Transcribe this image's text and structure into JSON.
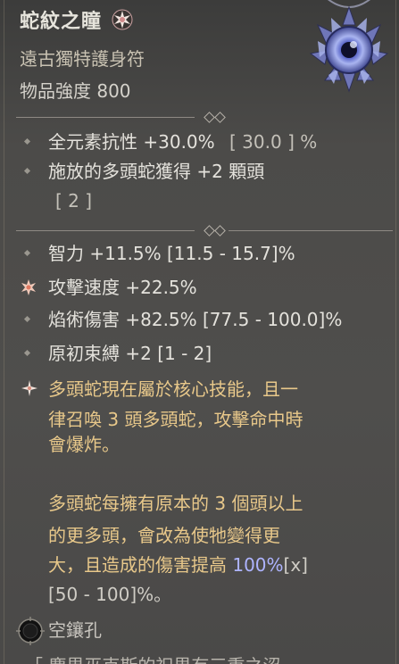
{
  "item": {
    "name": "蛇紋之瞳",
    "type": "遠古獨特護身符",
    "power": "物品強度 800"
  },
  "implicit": [
    {
      "text": "全元素抗性 +30.0%",
      "range": "[ 30.0 ] %"
    },
    {
      "text": "施放的多頭蛇獲得 +2 顆頭",
      "range": "[ 2 ]"
    }
  ],
  "affixes": [
    {
      "text": "智力 +11.5% [11.5 - 15.7]%",
      "bullet": "diamond"
    },
    {
      "text": "攻擊速度 +22.5%",
      "bullet": "star"
    },
    {
      "text": "焰術傷害 +82.5% [77.5 - 100.0]%",
      "bullet": "diamond"
    },
    {
      "text": "原初束縛 +2 [1 - 2]",
      "bullet": "diamond"
    }
  ],
  "aspect": {
    "line1": "多頭蛇現在屬於核心技能，且一",
    "line2": "律召喚 3 頭多頭蛇，攻擊命中時",
    "line3": "會爆炸。",
    "line4": "多頭蛇每擁有原本的 3 個頭以上",
    "line5": "的更多頭，會改為使牠變得更",
    "line6_prefix": "大，且造成的傷害提高 ",
    "line6_value": "100%",
    "line6_suffix": "[x]",
    "line7": "[50 - 100]%。"
  },
  "socket": {
    "label": "空鑲孔"
  },
  "flavor": "「 塵界巫克斯的祝界有三重之涩"
}
